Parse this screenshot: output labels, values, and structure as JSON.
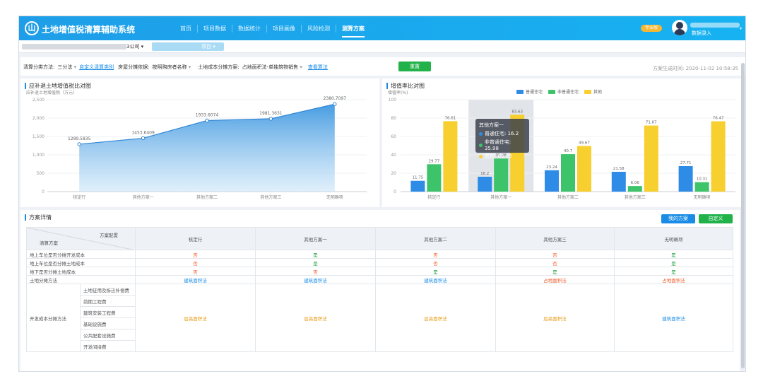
{
  "app": {
    "title": "土地增值税清算辅助系统",
    "logo_char": "山"
  },
  "nav": [
    "首页",
    "项目数据",
    "数据统计",
    "项目画像",
    "风险检测",
    "测算方案"
  ],
  "nav_active": 5,
  "user": {
    "badge": "专业版",
    "role": "数据录入",
    "caret": "▾"
  },
  "context": {
    "company_suffix": "3公司 ▾",
    "project_suffix": "项目 ▾"
  },
  "filters": {
    "clearing_method_label": "清算分类方法:",
    "clearing_method_value": "三分法",
    "custom_link": "自定义清算类别",
    "rate_label": "房屋分摊依据:",
    "rate_value": "按照购房者名称",
    "land_cost_label": "土地成本分摊方案:",
    "land_cost_value": "占地面积法-单独筑物销售",
    "view_link": "查看算法",
    "reset_button": "重置",
    "generated_time": "方案生成时间: 2020-11-02 10:58:35"
  },
  "colors": {
    "brand": "#1a9ee8",
    "blue": "#2e8ce6",
    "green": "#3dc46a",
    "yellow": "#f7cf2e",
    "red": "#f05a2a"
  },
  "line_panel": {
    "title": "应补退土地增值税比对图",
    "unit": "应补退土地增值税（万元）"
  },
  "bar_panel": {
    "title": "增值率比对图",
    "unit": "增值率(%)"
  },
  "chart_data": [
    {
      "type": "area",
      "title": "应补退土地增值税比对图",
      "ylabel": "应补退土地增值税（万元）",
      "categories": [
        "核定行",
        "其他方案一",
        "其他方案二",
        "其他方案三",
        "无明确项"
      ],
      "values": [
        1289.5835,
        1453.6409,
        1933.6074,
        1981.3631,
        2380.7097
      ],
      "ylim": [
        0,
        2500
      ],
      "yticks": [
        0,
        500,
        1000,
        1500,
        2000,
        2500
      ],
      "ytick_labels": [
        "0",
        "500",
        "1,000",
        "1,500",
        "2,000",
        "2,500"
      ],
      "grid": true
    },
    {
      "type": "bar",
      "title": "增值率比对图",
      "ylabel": "增值率(%)",
      "categories": [
        "核定行",
        "其他方案一",
        "其他方案二",
        "其他方案三",
        "无明确项"
      ],
      "series": [
        {
          "name": "普通住宅",
          "values": [
            11.75,
            16.2,
            23.24,
            21.58,
            27.71
          ]
        },
        {
          "name": "非普通住宅",
          "values": [
            29.77,
            35.98,
            40.7,
            6.06,
            10.31
          ]
        },
        {
          "name": "其他",
          "values": [
            76.61,
            83.63,
            49.67,
            71.87,
            76.47
          ]
        }
      ],
      "ylim": [
        0,
        100
      ],
      "yticks": [
        0,
        20,
        40,
        60,
        80,
        100
      ],
      "legend": "top-center",
      "highlight_category": 1,
      "grid": true
    }
  ],
  "tooltip": {
    "title": "其他方案一",
    "rows": [
      {
        "label": "普通住宅: 16.2",
        "color": "#2e8ce6"
      },
      {
        "label": "非普通住宅: 35.98",
        "color": "#3dc46a"
      },
      {
        "label": "其他: 83.63",
        "color": "#f7cf2e"
      }
    ]
  },
  "details": {
    "title": "方案详情",
    "btn_mine": "我的方案",
    "btn_custom": "自定义",
    "corner_top": "方案配置",
    "corner_bottom": "清算方案",
    "columns": [
      "核定行",
      "其他方案一",
      "其他方案二",
      "其他方案三",
      "无明确项"
    ],
    "rows": [
      {
        "label": "地上车位是否分摊开发成本",
        "cells": [
          [
            "否",
            "red"
          ],
          [
            "是",
            "green"
          ],
          [
            "否",
            "red"
          ],
          [
            "否",
            "red"
          ],
          [
            "是",
            "green"
          ]
        ]
      },
      {
        "label": "地上车位是否分摊土地成本",
        "cells": [
          [
            "否",
            "red"
          ],
          [
            "是",
            "green"
          ],
          [
            "否",
            "red"
          ],
          [
            "否",
            "red"
          ],
          [
            "是",
            "green"
          ]
        ]
      },
      {
        "label": "地下是否分摊土地成本",
        "cells": [
          [
            "否",
            "red"
          ],
          [
            "否",
            "red"
          ],
          [
            "是",
            "green"
          ],
          [
            "是",
            "green"
          ],
          [
            "是",
            "green"
          ]
        ]
      },
      {
        "label": "土地分摊方法",
        "cells": [
          [
            "建筑面积法",
            "blue"
          ],
          [
            "建筑面积法",
            "blue"
          ],
          [
            "建筑面积法",
            "blue"
          ],
          [
            "占地面积法",
            "red"
          ],
          [
            "占地面积法",
            "red"
          ]
        ]
      }
    ],
    "dev_group_label": "开发成本分摊方法",
    "dev_items": [
      "土地征用及拆迁补偿费",
      "前期工程费",
      "建筑安装工程费",
      "基础设施费",
      "公共配套设施费",
      "开发间接费"
    ],
    "dev_cells": [
      [
        "层高面积法",
        "orange"
      ],
      [
        "层高面积法",
        "orange"
      ],
      [
        "层高面积法",
        "orange"
      ],
      [
        "层高面积法",
        "orange"
      ],
      [
        "建筑面积法",
        "blue"
      ]
    ]
  }
}
